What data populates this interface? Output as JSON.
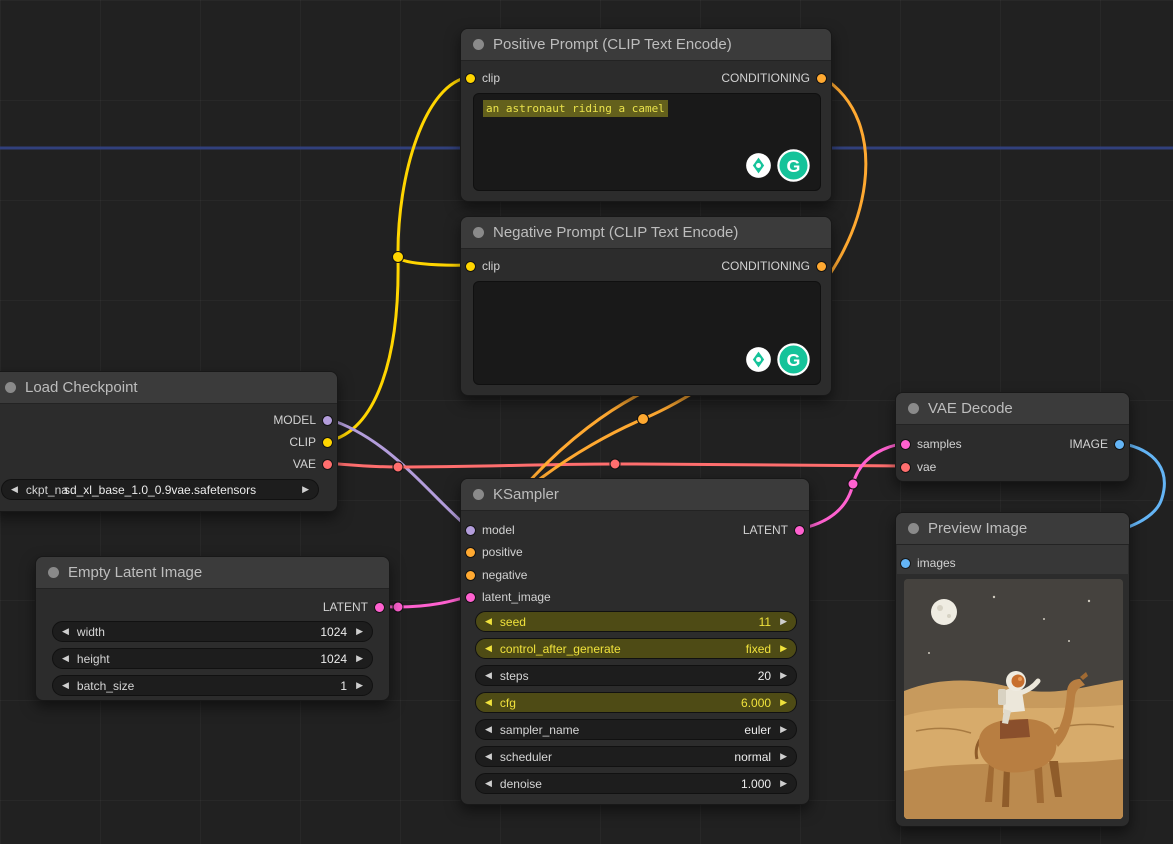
{
  "colors": {
    "model": "#b39ddb",
    "clip": "#ffd500",
    "vae": "#ff6e6e",
    "conditioning": "#ffa931",
    "latent": "#ff61d0",
    "image": "#64b5f6",
    "offscreen_blue": "#31407c",
    "grammarly": "#15c39a",
    "highlight": "#4e4b15",
    "highlight_text": "#f0e23c"
  },
  "icons": {
    "arrow_left": "◀",
    "arrow_right": "▶",
    "grammarly_g": "G"
  },
  "nodes": {
    "positive_prompt": {
      "title": "Positive Prompt (CLIP Text Encode)",
      "inputs": [
        "clip"
      ],
      "outputs": [
        "CONDITIONING"
      ],
      "text": "an astronaut riding a camel"
    },
    "negative_prompt": {
      "title": "Negative Prompt (CLIP Text Encode)",
      "inputs": [
        "clip"
      ],
      "outputs": [
        "CONDITIONING"
      ],
      "text": ""
    },
    "load_checkpoint": {
      "title": "Load Checkpoint",
      "outputs": [
        "MODEL",
        "CLIP",
        "VAE"
      ],
      "widgets": [
        {
          "label": "ckpt_na",
          "value": "sd_xl_base_1.0_0.9vae.safetensors"
        }
      ]
    },
    "empty_latent": {
      "title": "Empty Latent Image",
      "outputs": [
        "LATENT"
      ],
      "widgets": [
        {
          "label": "width",
          "value": "1024"
        },
        {
          "label": "height",
          "value": "1024"
        },
        {
          "label": "batch_size",
          "value": "1"
        }
      ]
    },
    "ksampler": {
      "title": "KSampler",
      "inputs": [
        "model",
        "positive",
        "negative",
        "latent_image"
      ],
      "outputs": [
        "LATENT"
      ],
      "widgets": [
        {
          "label": "seed",
          "value": "11",
          "highlight": true
        },
        {
          "label": "control_after_generate",
          "value": "fixed",
          "highlight": true
        },
        {
          "label": "steps",
          "value": "20",
          "highlight": false
        },
        {
          "label": "cfg",
          "value": "6.000",
          "highlight": true
        },
        {
          "label": "sampler_name",
          "value": "euler",
          "highlight": false
        },
        {
          "label": "scheduler",
          "value": "normal",
          "highlight": false
        },
        {
          "label": "denoise",
          "value": "1.000",
          "highlight": false
        }
      ]
    },
    "vae_decode": {
      "title": "VAE Decode",
      "inputs": [
        "samples",
        "vae"
      ],
      "outputs": [
        "IMAGE"
      ]
    },
    "preview_image": {
      "title": "Preview Image",
      "inputs": [
        "images"
      ]
    }
  }
}
